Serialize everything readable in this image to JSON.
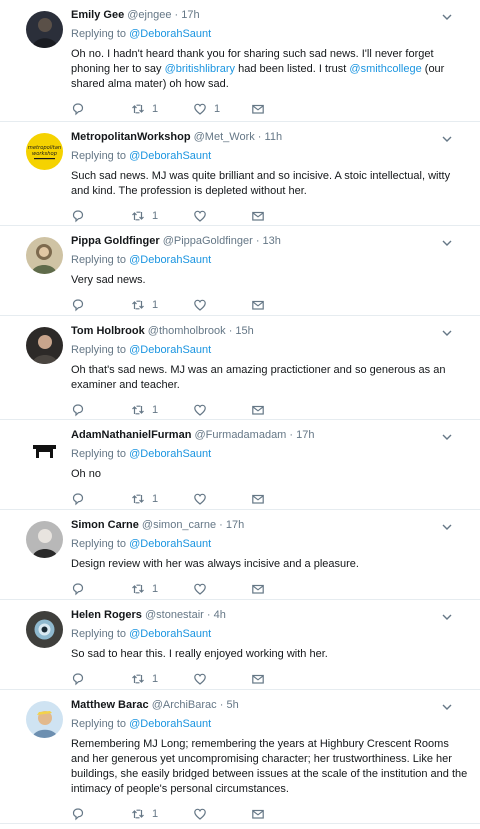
{
  "replying_prefix": "Replying to ",
  "replying_target": "@DeborahSaunt",
  "tweets": [
    {
      "name": "Emily Gee",
      "handle": "@ejngee",
      "time": "17h",
      "avatar_color": "#2b2f3a",
      "body_parts": [
        "Oh no. I hadn't heard thank you for sharing such sad news. I'll never forget phoning her to say ",
        "@britishlibrary",
        " had been listed. I trust ",
        "@smithcollege",
        " (our shared alma mater) oh how sad."
      ],
      "retweets": "1",
      "likes": "1"
    },
    {
      "name": "MetropolitanWorkshop",
      "handle": "@Met_Work",
      "time": "11h",
      "avatar_color": "#f5d200",
      "avatar_text": "metropolitan workshop",
      "body": "Such sad news. MJ was quite brilliant and so incisive. A stoic intellectual, witty and kind. The profession is depleted without her.",
      "retweets": "1",
      "likes": ""
    },
    {
      "name": "Pippa Goldfinger",
      "handle": "@PippaGoldfinger",
      "time": "13h",
      "avatar_color": "#8a7a5c",
      "body": "Very sad news.",
      "retweets": "1",
      "likes": ""
    },
    {
      "name": "Tom Holbrook",
      "handle": "@thomholbrook",
      "time": "15h",
      "avatar_color": "#3a3532",
      "body": "Oh that's sad news. MJ was an amazing practictioner and so generous as an examiner and teacher.",
      "retweets": "1",
      "likes": ""
    },
    {
      "name": "AdamNathanielFurman",
      "handle": "@Furmadamadam",
      "time": "17h",
      "avatar_color": "#ffffff",
      "body": "Oh no",
      "retweets": "1",
      "likes": ""
    },
    {
      "name": "Simon Carne",
      "handle": "@simon_carne",
      "time": "17h",
      "avatar_color": "#9a9a9a",
      "body": "Design review with her was always incisive and a pleasure.",
      "retweets": "1",
      "likes": ""
    },
    {
      "name": "Helen Rogers",
      "handle": "@stonestair",
      "time": "4h",
      "avatar_color": "#4a4a48",
      "body": "So sad to hear this. I really enjoyed working with her.",
      "retweets": "1",
      "likes": ""
    },
    {
      "name": "Matthew Barac",
      "handle": "@ArchiBarac",
      "time": "5h",
      "avatar_color": "#9fc3e0",
      "body": "Remembering MJ Long; remembering the years at Highbury Crescent Rooms and her generous yet uncompromising character; her trustworthiness. Like her buildings, she easily bridged between issues at the scale of the institution and the intimacy of people's personal circumstances.",
      "retweets": "1",
      "likes": ""
    }
  ],
  "icons": {
    "reply": "reply-icon",
    "retweet": "retweet-icon",
    "like": "heart-icon",
    "dm": "envelope-icon",
    "more": "chevron-down-icon"
  },
  "colors": {
    "link": "#1b95e0",
    "meta": "#657786",
    "divider": "#e6ecf0"
  }
}
